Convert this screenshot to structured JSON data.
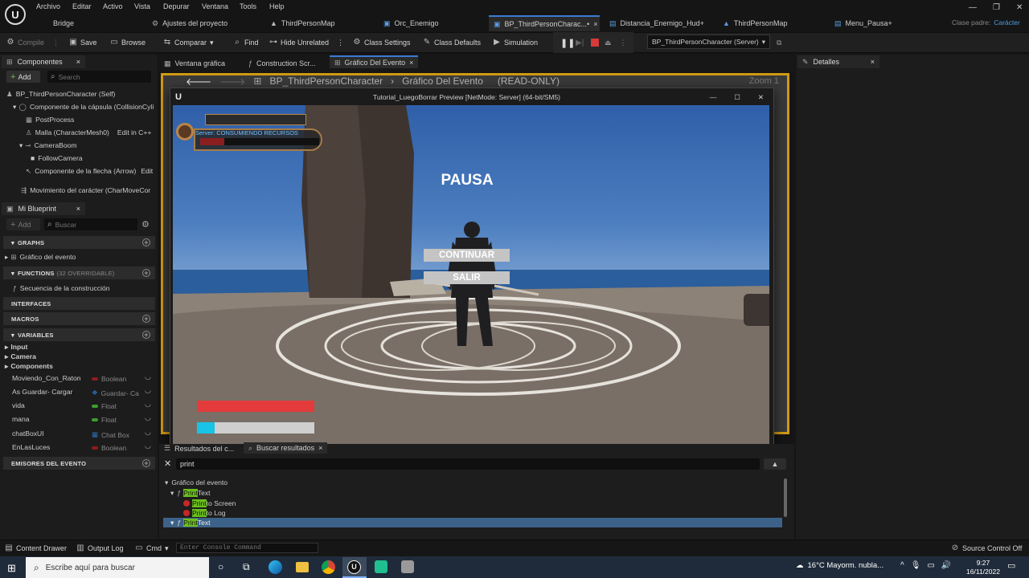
{
  "menu": [
    "Archivo",
    "Editar",
    "Activo",
    "Vista",
    "Depurar",
    "Ventana",
    "Tools",
    "Help"
  ],
  "tabs": [
    {
      "label": "Bridge"
    },
    {
      "label": "Ajustes del proyecto"
    },
    {
      "label": "ThirdPersonMap"
    },
    {
      "label": "Orc_Enemigo"
    },
    {
      "label": "BP_ThirdPersonCharac...•",
      "close": "×"
    },
    {
      "label": "Distancia_Enemigo_Hud+"
    },
    {
      "label": "ThirdPersonMap"
    },
    {
      "label": "Menu_Pausa+"
    }
  ],
  "parent_class": {
    "label": "Clase padre:",
    "value": "Carácter"
  },
  "toolbar": {
    "compile": "Compile",
    "save": "Save",
    "browse": "Browse",
    "compare": "Comparar",
    "find": "Find",
    "hide_unrelated": "Hide Unrelated",
    "class_settings": "Class Settings",
    "class_defaults": "Class Defaults",
    "simulation": "Simulation",
    "debug_target": "BP_ThirdPersonCharacter (Server)"
  },
  "components": {
    "title": "Componentes",
    "add": "Add",
    "search_placeholder": "Search",
    "items": [
      {
        "label": "BP_ThirdPersonCharacter (Self)"
      },
      {
        "label": "Componente de la cápsula (CollisionCyli"
      },
      {
        "label": "PostProcess"
      },
      {
        "label": "Malla (CharacterMesh0)",
        "extra": "Edit in C++"
      },
      {
        "label": "CameraBoom"
      },
      {
        "label": "FollowCamera"
      },
      {
        "label": "Componente de la flecha (Arrow)",
        "extra": "Edit"
      },
      {
        "label": "Movimiento del carácter (CharMoveCor"
      }
    ]
  },
  "my_blueprint": {
    "title": "Mi Blueprint",
    "add": "Add",
    "search_placeholder": "Buscar",
    "graphs_header": "GRAPHS",
    "graph_item": "Gráfico del evento",
    "functions_header": "FUNCTIONS",
    "functions_count": "(32 OVERRIDABLE)",
    "function_item": "Secuencia de la construcción",
    "interfaces_header": "INTERFACES",
    "macros_header": "MACROS",
    "variables_header": "VARIABLES",
    "categories": [
      "Input",
      "Camera",
      "Components"
    ],
    "variables": [
      {
        "name": "Moviendo_Con_Raton",
        "type": "Boolean",
        "color": "#8c1c1c"
      },
      {
        "name": "As Guardar- Cargar",
        "type": "Guardar- Ca",
        "color": "#2d6fb5"
      },
      {
        "name": "vida",
        "type": "Float",
        "color": "#3d9c2b"
      },
      {
        "name": "mana",
        "type": "Float",
        "color": "#3d9c2b"
      },
      {
        "name": "chatBoxUI",
        "type": "Chat Box",
        "color": "#2d6fb5"
      },
      {
        "name": "EnLasLuces",
        "type": "Boolean",
        "color": "#8c1c1c"
      }
    ],
    "dispatchers_header": "EMISORES DEL EVENTO"
  },
  "editor_tabs": [
    {
      "label": "Ventana gráfica"
    },
    {
      "label": "Construction Scr..."
    },
    {
      "label": "Gráfico Del Evento",
      "close": "×"
    }
  ],
  "details": {
    "title": "Detalles"
  },
  "graph_header": {
    "path": "BP_ThirdPersonCharacter",
    "separator": "›",
    "graph": "Gráfico Del Evento",
    "mode": "(READ-ONLY)",
    "zoom": "Zoom 1"
  },
  "game_window": {
    "title": "Tutorial_LuegoBorrar Preview [NetMode: Server]  (64-bit/SM5)",
    "hud_label": "Server: CONSUMIENDO RECURSOS",
    "pause_title": "PAUSA",
    "continue": "CONTINUAR",
    "exit": "SALIR",
    "health_fraction": 1.0,
    "mana_fraction": 0.15
  },
  "bottom_tabs": [
    {
      "label": "Resultados del c..."
    },
    {
      "label": "Buscar resultados",
      "close": "×"
    }
  ],
  "find": {
    "query": "print",
    "results": [
      {
        "text": "Gráfico del evento",
        "level": 0
      },
      {
        "highlight": "Print",
        "rest": " Text",
        "level": 1
      },
      {
        "highlight": "Print",
        "rest": " to Screen",
        "level": 2
      },
      {
        "highlight": "Print",
        "rest": " to Log",
        "level": 2
      },
      {
        "highlight": "Print",
        "rest": " Text",
        "level": 1
      }
    ]
  },
  "statusbar": {
    "content_drawer": "Content Drawer",
    "output_log": "Output Log",
    "cmd": "Cmd",
    "console_placeholder": "Enter Console Command",
    "source_control": "Source Control Off"
  },
  "taskbar": {
    "search_placeholder": "Escribe aquí para buscar",
    "weather": "16°C  Mayorm. nubla...",
    "time": "9:27",
    "date": "16/11/2022"
  }
}
